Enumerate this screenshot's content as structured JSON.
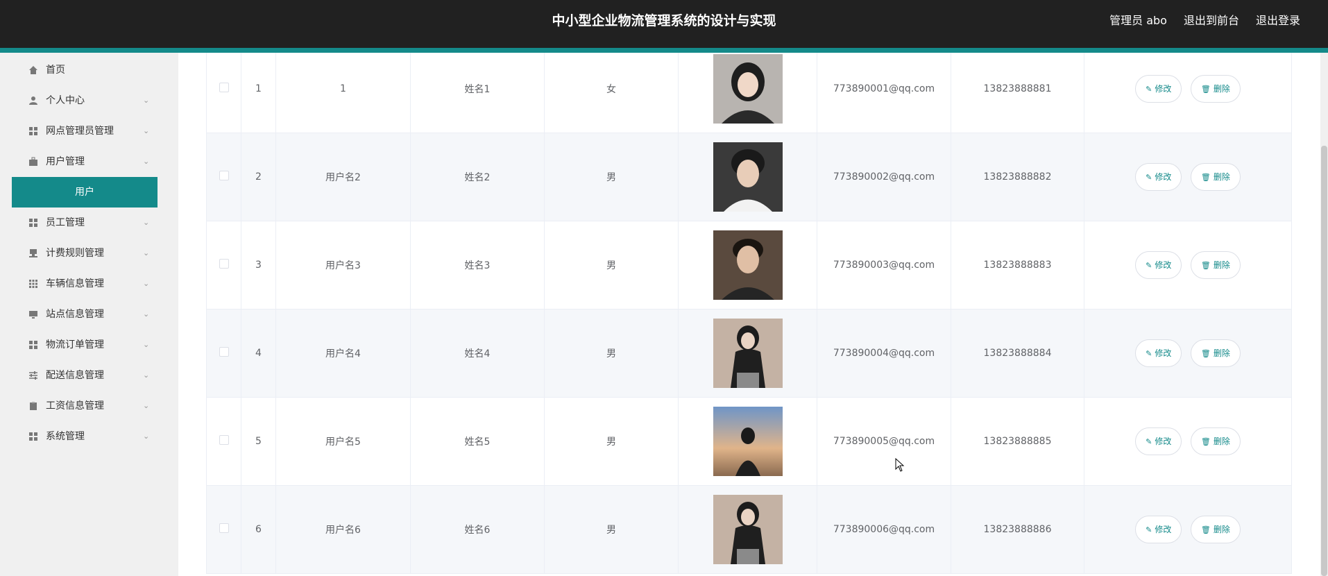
{
  "header": {
    "title": "中小型企业物流管理系统的设计与实现",
    "admin": "管理员 abo",
    "to_front": "退出到前台",
    "logout": "退出登录"
  },
  "sidebar": {
    "items": [
      {
        "label": "首页",
        "icon": "home-icon"
      },
      {
        "label": "个人中心",
        "icon": "user-icon"
      },
      {
        "label": "网点管理员管理",
        "icon": "grid-icon"
      },
      {
        "label": "用户管理",
        "icon": "briefcase-icon"
      },
      {
        "label": "员工管理",
        "icon": "grid-icon"
      },
      {
        "label": "计费规则管理",
        "icon": "stamp-icon"
      },
      {
        "label": "车辆信息管理",
        "icon": "grid9-icon"
      },
      {
        "label": "站点信息管理",
        "icon": "monitor-icon"
      },
      {
        "label": "物流订单管理",
        "icon": "grid-icon"
      },
      {
        "label": "配送信息管理",
        "icon": "sliders-icon"
      },
      {
        "label": "工资信息管理",
        "icon": "clipboard-icon"
      },
      {
        "label": "系统管理",
        "icon": "grid-icon"
      }
    ],
    "active_sub": "用户"
  },
  "table": {
    "rows": [
      {
        "index": "1",
        "username": "1",
        "name": "姓名1",
        "gender": "女",
        "email": "773890001@qq.com",
        "phone": "13823888881"
      },
      {
        "index": "2",
        "username": "用户名2",
        "name": "姓名2",
        "gender": "男",
        "email": "773890002@qq.com",
        "phone": "13823888882"
      },
      {
        "index": "3",
        "username": "用户名3",
        "name": "姓名3",
        "gender": "男",
        "email": "773890003@qq.com",
        "phone": "13823888883"
      },
      {
        "index": "4",
        "username": "用户名4",
        "name": "姓名4",
        "gender": "男",
        "email": "773890004@qq.com",
        "phone": "13823888884"
      },
      {
        "index": "5",
        "username": "用户名5",
        "name": "姓名5",
        "gender": "男",
        "email": "773890005@qq.com",
        "phone": "13823888885"
      },
      {
        "index": "6",
        "username": "用户名6",
        "name": "姓名6",
        "gender": "男",
        "email": "773890006@qq.com",
        "phone": "13823888886"
      }
    ],
    "edit_label": "修改",
    "delete_label": "删除"
  },
  "colors": {
    "accent": "#148a8a",
    "header_bg": "#212121"
  }
}
